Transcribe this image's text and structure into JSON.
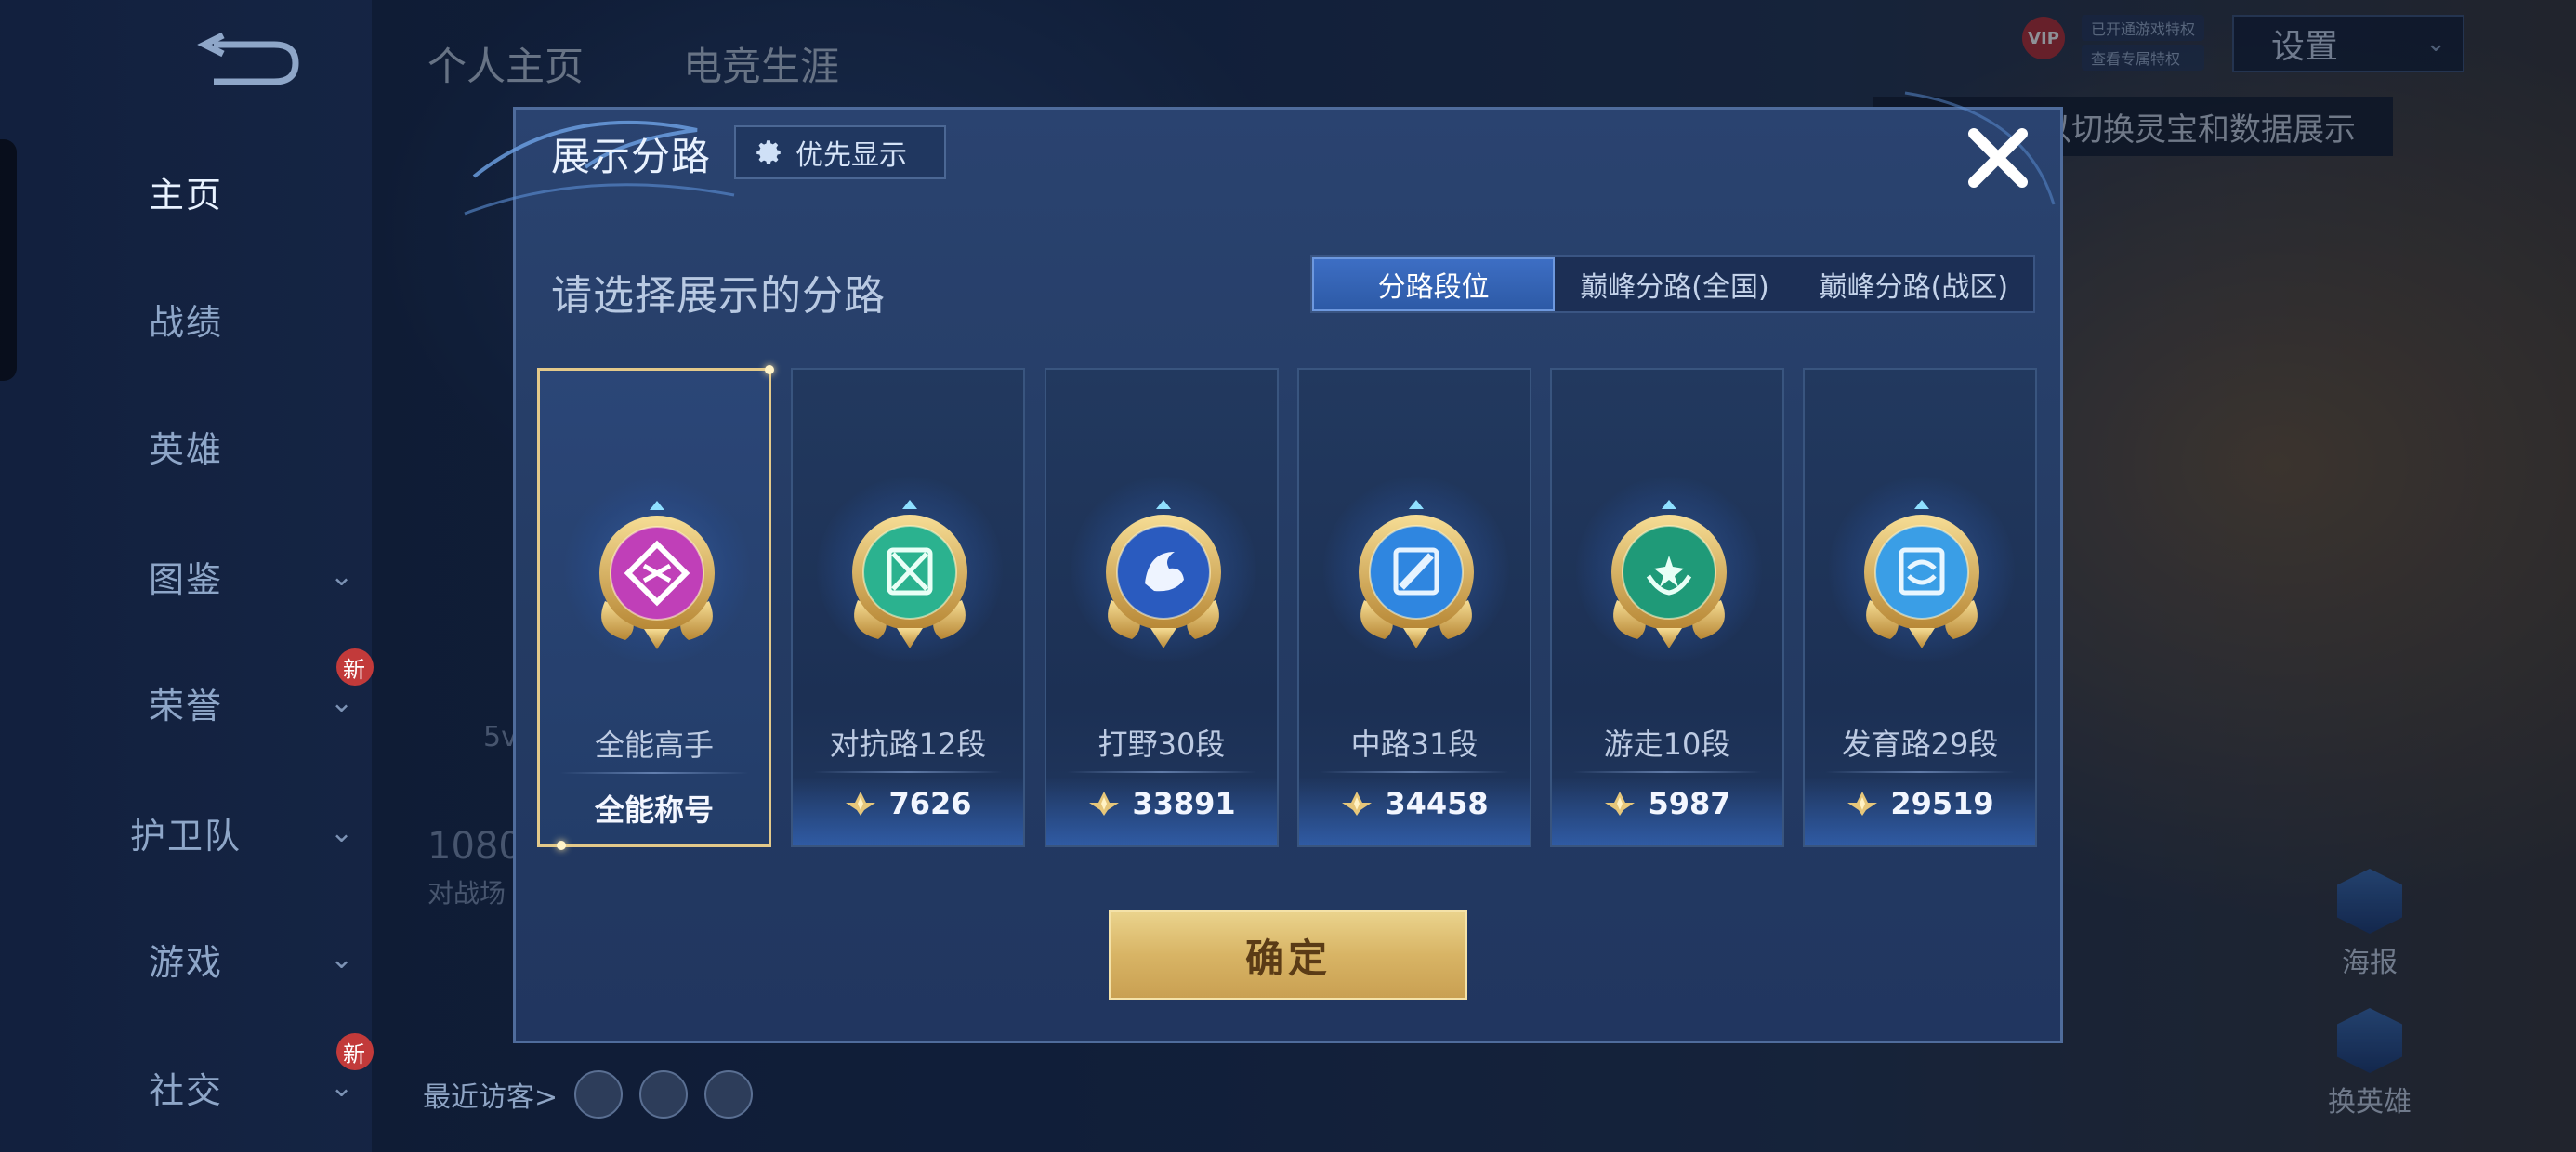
{
  "nav": {
    "items": [
      {
        "label": "主页",
        "active": true,
        "chevron": false,
        "badge": ""
      },
      {
        "label": "战绩",
        "active": false,
        "chevron": false,
        "badge": ""
      },
      {
        "label": "英雄",
        "active": false,
        "chevron": false,
        "badge": ""
      },
      {
        "label": "图鉴",
        "active": false,
        "chevron": true,
        "badge": ""
      },
      {
        "label": "荣誉",
        "active": false,
        "chevron": true,
        "badge": "新"
      },
      {
        "label": "护卫队",
        "active": false,
        "chevron": true,
        "badge": ""
      },
      {
        "label": "游戏",
        "active": false,
        "chevron": true,
        "badge": ""
      },
      {
        "label": "社交",
        "active": false,
        "chevron": true,
        "badge": "新"
      }
    ]
  },
  "top_tabs": [
    "个人主页",
    "电竞生涯"
  ],
  "header": {
    "settings_label": "设置",
    "vip_label": "VIP",
    "vip_tags": [
      "已开通游戏特权",
      "查看专属特权"
    ],
    "hint_text": "以切换灵宝和数据展示"
  },
  "background_fragments": {
    "number": "1080",
    "sub": "对战场",
    "small": "5v"
  },
  "visitors_label": "最近访客>",
  "side_actions": [
    "海报",
    "换英雄"
  ],
  "modal": {
    "title": "展示分路",
    "priority_label": "优先显示",
    "prompt": "请选择展示的分路",
    "tabs": [
      {
        "label": "分路段位",
        "active": true
      },
      {
        "label": "巅峰分路(全国)",
        "active": false
      },
      {
        "label": "巅峰分路(战区)",
        "active": false
      }
    ],
    "cards": [
      {
        "name": "全能高手",
        "value": "全能称号",
        "icon": "all-round-badge-icon",
        "color": "#c03fb8",
        "selected": true,
        "is_title": true
      },
      {
        "name": "对抗路12段",
        "value": "7626",
        "icon": "clash-lane-badge-icon",
        "color": "#2bb28f",
        "selected": false,
        "is_title": false
      },
      {
        "name": "打野30段",
        "value": "33891",
        "icon": "jungle-badge-icon",
        "color": "#2a5bbf",
        "selected": false,
        "is_title": false
      },
      {
        "name": "中路31段",
        "value": "34458",
        "icon": "mid-lane-badge-icon",
        "color": "#2f86e0",
        "selected": false,
        "is_title": false
      },
      {
        "name": "游走10段",
        "value": "5987",
        "icon": "roam-badge-icon",
        "color": "#1f9a78",
        "selected": false,
        "is_title": false
      },
      {
        "name": "发育路29段",
        "value": "29519",
        "icon": "farm-lane-badge-icon",
        "color": "#3a9ee6",
        "selected": false,
        "is_title": false
      }
    ],
    "confirm_label": "确定"
  },
  "colors": {
    "gold": "#d8b465",
    "modal_bg": "#243b63",
    "tab_active": "#2d5aa6"
  }
}
